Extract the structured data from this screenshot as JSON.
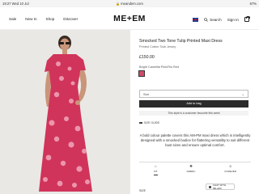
{
  "status_bar": {
    "time": "19:27  Wed 10 Jul",
    "url": "meandem.com",
    "lock_icon": "lock-icon",
    "battery": "67%"
  },
  "header": {
    "nav": [
      "Sale",
      "New In",
      "Shop",
      "Discover"
    ],
    "logo": "ME+EM",
    "search_label": "Search",
    "sign_in_label": "Sign In",
    "flag_icon": "uk-flag-icon",
    "bag_icon": "bag-icon"
  },
  "product": {
    "title": "Smocked Two Tone Tulip Printed Maxi Dress",
    "subtitle": "Printed Cotton Slub Jersey",
    "price": "£150.00",
    "colour_name": "Bright Camellia Pink/Rio Red",
    "swatch_color": "#d04a6a",
    "size_label": "Size",
    "add_to_bag": "Add to bag",
    "favourite_note": "This style is a customer favourite this week",
    "size_guide": "SIZE GUIDE",
    "description": "A bold colour palette covers this AM-PM maxi dress which is intelligently designed with a smocked bodice for flattering versatility to suit different bust sizes and ensure optimal comfort."
  },
  "tabs": [
    {
      "label": "FIT",
      "icon": "hanger-icon"
    },
    {
      "label": "FABRIC",
      "icon": "fabric-icon"
    },
    {
      "label": "FOREVER",
      "icon": "forever-icon"
    }
  ],
  "size_section": "SIZE",
  "chat": {
    "label": "CHAT WITH ME+EM",
    "icon": "chat-icon"
  }
}
